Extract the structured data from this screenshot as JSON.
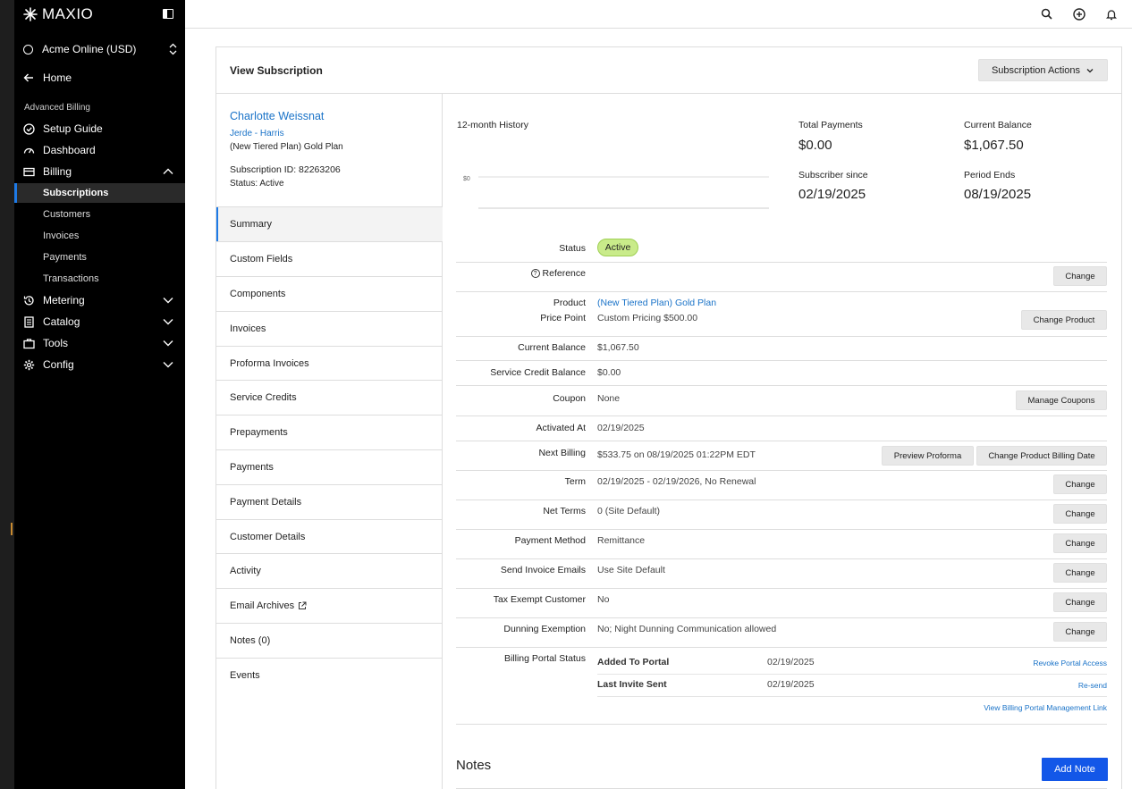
{
  "sidebar": {
    "brand": "MAXIO",
    "org": "Acme Online (USD)",
    "home": "Home",
    "section": "Advanced Billing",
    "items": [
      {
        "label": "Setup Guide",
        "icon": "check-circle-icon"
      },
      {
        "label": "Dashboard",
        "icon": "gauge-icon"
      },
      {
        "label": "Billing",
        "icon": "billing-icon",
        "expanded": true
      },
      {
        "label": "Metering",
        "icon": "history-icon"
      },
      {
        "label": "Catalog",
        "icon": "catalog-icon"
      },
      {
        "label": "Tools",
        "icon": "briefcase-icon"
      },
      {
        "label": "Config",
        "icon": "gear-icon"
      }
    ],
    "billing_sub": [
      "Subscriptions",
      "Customers",
      "Invoices",
      "Payments",
      "Transactions"
    ],
    "active_sub": "Subscriptions"
  },
  "header": {
    "title": "View Subscription",
    "actions_label": "Subscription Actions"
  },
  "customer": {
    "name": "Charlotte Weissnat",
    "company": "Jerde - Harris",
    "plan": "(New Tiered Plan) Gold Plan",
    "subscription_id": "Subscription ID: 82263206",
    "status": "Status: Active"
  },
  "tabs": [
    "Summary",
    "Custom Fields",
    "Components",
    "Invoices",
    "Proforma Invoices",
    "Service Credits",
    "Prepayments",
    "Payments",
    "Payment Details",
    "Customer Details",
    "Activity",
    "Email Archives",
    "Notes (0)",
    "Events"
  ],
  "active_tab": "Summary",
  "history": {
    "title": "12-month History",
    "axis_label": "$0"
  },
  "stats": {
    "total_payments_label": "Total Payments",
    "total_payments": "$0.00",
    "current_balance_label": "Current Balance",
    "current_balance": "$1,067.50",
    "subscriber_since_label": "Subscriber since",
    "subscriber_since": "02/19/2025",
    "period_ends_label": "Period Ends",
    "period_ends": "08/19/2025"
  },
  "details": {
    "status_label": "Status",
    "status_value": "Active",
    "reference_label": "Reference",
    "product_label": "Product",
    "product_value": "(New Tiered Plan) Gold Plan",
    "price_point_label": "Price Point",
    "price_point_value": "Custom Pricing $500.00",
    "current_balance_label": "Current Balance",
    "current_balance_value": "$1,067.50",
    "service_credit_label": "Service Credit Balance",
    "service_credit_value": "$0.00",
    "coupon_label": "Coupon",
    "coupon_value": "None",
    "activated_label": "Activated At",
    "activated_value": "02/19/2025",
    "next_billing_label": "Next Billing",
    "next_billing_value": "$533.75 on 08/19/2025 01:22PM EDT",
    "term_label": "Term",
    "term_value": "02/19/2025 - 02/19/2026, No Renewal",
    "net_terms_label": "Net Terms",
    "net_terms_value": "0 (Site Default)",
    "payment_method_label": "Payment Method",
    "payment_method_value": "Remittance",
    "send_emails_label": "Send Invoice Emails",
    "send_emails_value": "Use Site Default",
    "tax_exempt_label": "Tax Exempt Customer",
    "tax_exempt_value": "No",
    "dunning_label": "Dunning Exemption",
    "dunning_value": "No; Night Dunning Communication allowed",
    "portal_label": "Billing Portal Status",
    "added_label": "Added To Portal",
    "added_value": "02/19/2025",
    "invite_label": "Last Invite Sent",
    "invite_value": "02/19/2025"
  },
  "buttons": {
    "change": "Change",
    "change_product": "Change Product",
    "manage_coupons": "Manage Coupons",
    "preview_proforma": "Preview Proforma",
    "change_billing_date": "Change Product Billing Date",
    "revoke_portal": "Revoke Portal Access",
    "resend": "Re-send",
    "view_portal_link": "View Billing Portal Management Link",
    "add_note": "Add Note"
  },
  "notes": {
    "title": "Notes"
  },
  "colors": {
    "link": "#1a73c8",
    "primary": "#1357e8",
    "active_pill": "#c9eb8a"
  }
}
